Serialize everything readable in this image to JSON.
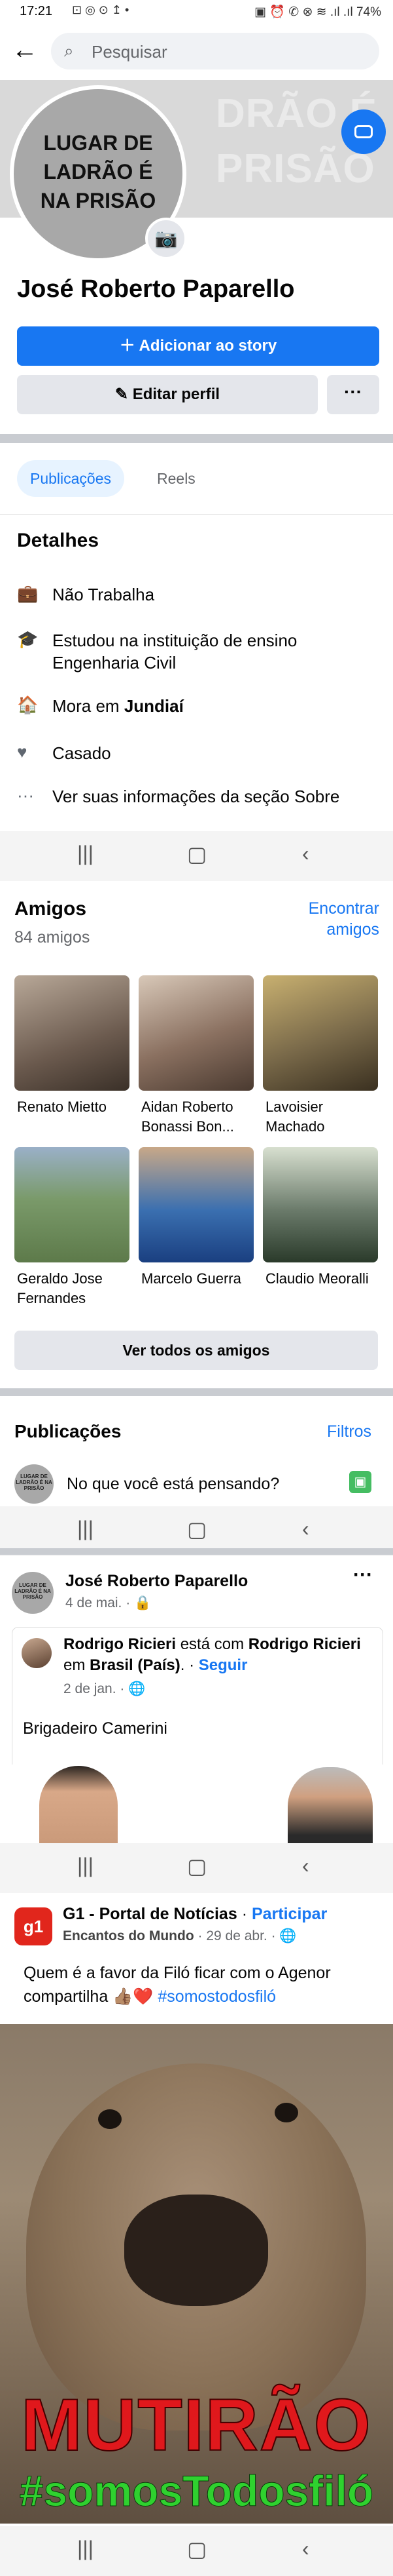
{
  "status_bar": {
    "time": "17:21",
    "left_icons": "⊡ ◎ ⊙ ↥ •",
    "right_icons": "▣ ⏰ ✆ ⊗ ≋ .ıl .ıl",
    "battery": "74%"
  },
  "topbar": {
    "back_icon": "arrow-left-icon",
    "search_placeholder": "Pesquisar"
  },
  "cover": {
    "ghost_text": "DRÃO É\nPRISÃO"
  },
  "profile": {
    "avatar_text": "LUGAR DE\nLADRÃO É\nNA PRISÃO",
    "name": "José Roberto Paparello",
    "add_story": "Adicionar ao story",
    "edit_profile": "Editar perfil",
    "more": "···"
  },
  "tabs": [
    {
      "label": "Publicações",
      "active": true
    },
    {
      "label": "Reels",
      "active": false
    }
  ],
  "details": {
    "title": "Detalhes",
    "items": [
      {
        "icon": "briefcase-icon",
        "glyph": "💼",
        "text": "Não Trabalha"
      },
      {
        "icon": "graduation-cap-icon",
        "glyph": "🎓",
        "text": "Estudou na instituição de ensino Engenharia Civil"
      },
      {
        "icon": "home-icon",
        "glyph": "🏠",
        "text_prefix": "Mora em ",
        "text_bold": "Jundiaí"
      },
      {
        "icon": "heart-icon",
        "glyph": "♥",
        "text": "Casado"
      },
      {
        "icon": "more-dots-icon",
        "glyph": "···",
        "text": "Ver suas informações da seção Sobre"
      }
    ]
  },
  "nav": {
    "recent": "|||",
    "home": "▢",
    "back": "‹"
  },
  "friends": {
    "title": "Amigos",
    "count": "84 amigos",
    "find": "Encontrar amigos",
    "see_all": "Ver todos os amigos",
    "list": [
      {
        "name": "Renato Mietto",
        "color": "#6b5a4e"
      },
      {
        "name": "Aidan Roberto Bonassi Bon...",
        "color": "#8a7060"
      },
      {
        "name": "Lavoisier Machado",
        "color": "#7a6a4a"
      },
      {
        "name": "Geraldo Jose Fernandes",
        "color": "#5d7a4a"
      },
      {
        "name": "Marcelo Guerra",
        "color": "#3a6fb0"
      },
      {
        "name": "Claudio Meoralli",
        "color": "#6a7a6a"
      }
    ]
  },
  "publications": {
    "title": "Publicações",
    "filters": "Filtros",
    "composer_placeholder": "No que você está pensando?",
    "mini_avatar_text": "LUGAR DE LADRÃO É NA PRISÃO"
  },
  "post1": {
    "author": "José Roberto Paparello",
    "date": "4 de mai. ·",
    "more": "···",
    "shared_author": "Rodrigo Ricieri",
    "shared_with_text": " está com ",
    "shared_with": "Rodrigo Ricieri",
    "shared_in_text": " em ",
    "shared_place": "Brasil (País)",
    "shared_dot": ". ·",
    "follow": "Seguir",
    "shared_date": "2 de jan. ·",
    "shared_body": "Brigadeiro Camerini"
  },
  "post2": {
    "page_name": "G1 - Portal de Notícias",
    "dot": " · ",
    "join": "Participar",
    "sub_group": "Encantos do Mundo",
    "sub_date": " · 29 de abr. ·",
    "body_line1": "Quem é a favor da Filó ficar com o Agenor",
    "body_line2_prefix": "compartilha ",
    "body_emoji": "👍🏽❤️",
    "body_hashtag": " #somostodosfiló",
    "image_text_1": "MUTIRÃO",
    "image_text_2": "#somosTodosfiló"
  },
  "colors": {
    "accent": "#1877f2",
    "background": "#ffffff",
    "separator": "#c9ccd1",
    "text_secondary": "#65676b"
  }
}
